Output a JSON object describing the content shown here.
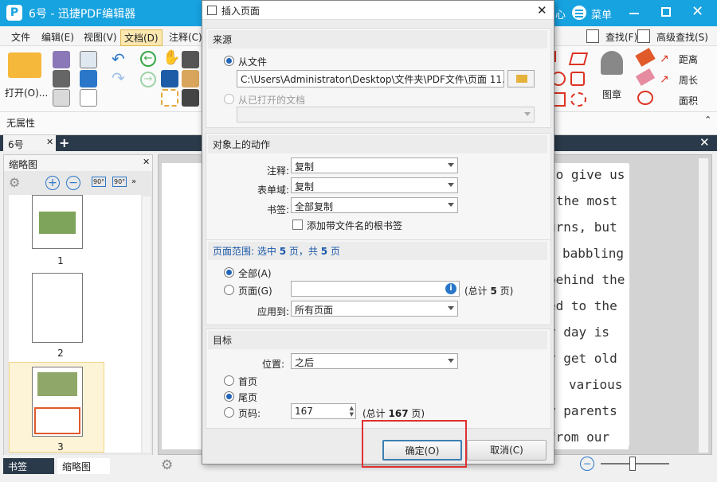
{
  "app": {
    "title": "6号 - 迅捷PDF编辑器",
    "icon_letter": "P",
    "right_partial": "心",
    "menu_label": "菜单"
  },
  "menubar": {
    "items": [
      "文件",
      "编辑(E)",
      "视图(V)",
      "文档(D)",
      "注释(C)"
    ],
    "right": [
      "查找(F)",
      "高级查找(S)"
    ]
  },
  "ribbon": {
    "open_label": "打开(O)...",
    "stamp_label": "图章",
    "measure": [
      "距离",
      "周长",
      "面积"
    ],
    "props_label": "无属性"
  },
  "doc_tab": {
    "label": "6号"
  },
  "thumb_panel": {
    "title": "缩略图",
    "pages": [
      "1",
      "2",
      "3"
    ],
    "rotate_labels": [
      "90°",
      "90°"
    ]
  },
  "bottom_tabs": {
    "bookmarks": "书签",
    "thumbnails": "缩略图"
  },
  "doc_text": [
    "to give us",
    "the most",
    "urns, but",
    "babbling",
    "behind the",
    "ed to the",
    "y day is",
    "y get old",
    "various",
    "r parents",
    "from our"
  ],
  "dialog": {
    "title": "插入页面",
    "source": {
      "title": "来源",
      "from_file": "从文件",
      "file_path": "C:\\Users\\Administrator\\Desktop\\文件夹\\PDF文件\\页面 11.pdf",
      "from_open": "从已打开的文档"
    },
    "actions": {
      "title": "对象上的动作",
      "comments_label": "注释:",
      "comments_value": "复制",
      "forms_label": "表单域:",
      "forms_value": "复制",
      "bookmarks_label": "书签:",
      "bookmarks_value": "全部复制",
      "root_bookmark": "添加带文件名的根书签"
    },
    "range": {
      "title_prefix": "页面范围: 选中 ",
      "selected": "5",
      "mid": " 页，共 ",
      "total": "5",
      "suffix": " 页",
      "all": "全部(A)",
      "pages": "页面(G)",
      "total_note_prefix": "(总计 ",
      "total_note_num": "5",
      "total_note_suffix": " 页)",
      "apply_label": "应用到:",
      "apply_value": "所有页面"
    },
    "target": {
      "title": "目标",
      "position_label": "位置:",
      "position_value": "之后",
      "first": "首页",
      "last": "尾页",
      "page_num": "页码:",
      "page_value": "167",
      "total_prefix": "(总计 ",
      "total_num": "167",
      "total_suffix": " 页)"
    },
    "ok_label": "确定(O)",
    "cancel_label": "取消(C)"
  }
}
